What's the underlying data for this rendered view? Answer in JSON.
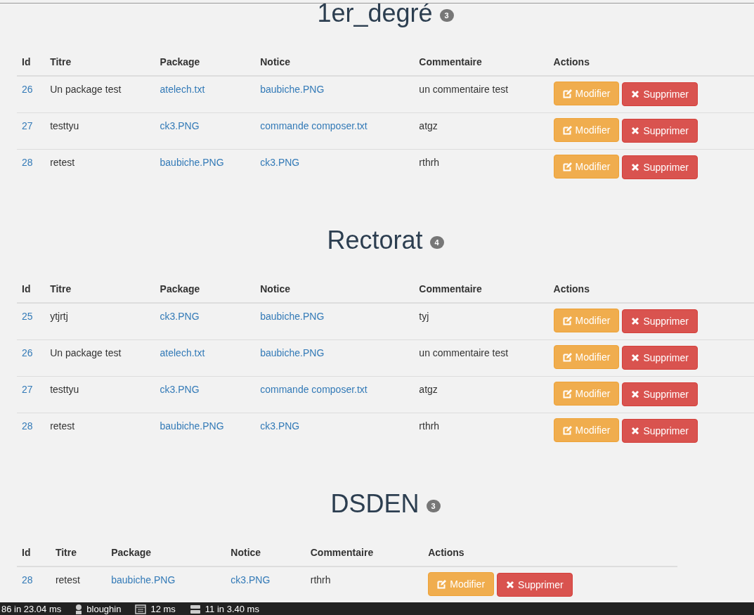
{
  "sections": [
    {
      "title": "1er_degré",
      "count": "3",
      "columns": [
        "Id",
        "Titre",
        "Package",
        "Notice",
        "Commentaire",
        "Actions"
      ],
      "rows": [
        {
          "id": "26",
          "titre": "Un package test",
          "package": "atelech.txt",
          "notice": "baubiche.PNG",
          "commentaire": "un commentaire test",
          "actions": [
            "Modifier",
            "Supprimer"
          ]
        },
        {
          "id": "27",
          "titre": "testtyu",
          "package": "ck3.PNG",
          "notice": "commande composer.txt",
          "commentaire": "atgz",
          "actions": [
            "Modifier",
            "Supprimer"
          ]
        },
        {
          "id": "28",
          "titre": "retest",
          "package": "baubiche.PNG",
          "notice": "ck3.PNG",
          "commentaire": "rthrh",
          "actions": [
            "Modifier",
            "Supprimer"
          ]
        }
      ]
    },
    {
      "title": "Rectorat",
      "count": "4",
      "columns": [
        "Id",
        "Titre",
        "Package",
        "Notice",
        "Commentaire",
        "Actions"
      ],
      "rows": [
        {
          "id": "25",
          "titre": "ytjrtj",
          "package": "ck3.PNG",
          "notice": "baubiche.PNG",
          "commentaire": "tyj",
          "actions": [
            "Modifier",
            "Supprimer"
          ]
        },
        {
          "id": "26",
          "titre": "Un package test",
          "package": "atelech.txt",
          "notice": "baubiche.PNG",
          "commentaire": "un commentaire test",
          "actions": [
            "Modifier",
            "Supprimer"
          ]
        },
        {
          "id": "27",
          "titre": "testtyu",
          "package": "ck3.PNG",
          "notice": "commande composer.txt",
          "commentaire": "atgz",
          "actions": [
            "Modifier",
            "Supprimer"
          ]
        },
        {
          "id": "28",
          "titre": "retest",
          "package": "baubiche.PNG",
          "notice": "ck3.PNG",
          "commentaire": "rthrh",
          "actions": [
            "Modifier",
            "Supprimer"
          ]
        }
      ]
    },
    {
      "title": "DSDEN",
      "count": "3",
      "columns": [
        "Id",
        "Titre",
        "Package",
        "Notice",
        "Commentaire",
        "Actions"
      ],
      "rows": [
        {
          "id": "28",
          "titre": "retest",
          "package": "baubiche.PNG",
          "notice": "ck3.PNG",
          "commentaire": "rthrh",
          "actions": [
            "Modifier",
            "Supprimer"
          ]
        }
      ]
    }
  ],
  "debug_bar": [
    {
      "kind": "requests",
      "text": "86 in 23.04 ms"
    },
    {
      "kind": "user",
      "text": "bloughin"
    },
    {
      "kind": "time",
      "text": "12 ms"
    },
    {
      "kind": "db",
      "text": "11 in 3.40 ms"
    }
  ]
}
